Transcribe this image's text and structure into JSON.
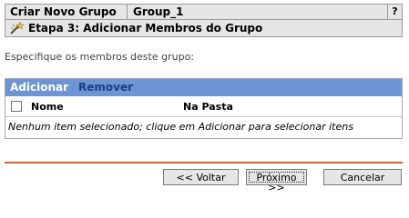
{
  "header": {
    "title": "Criar Novo Grupo",
    "object_name": "Group_1",
    "help_label": "?"
  },
  "step": {
    "icon": "wizard-wand-icon",
    "label": "Etapa 3: Adicionar Membros do Grupo"
  },
  "instruction": "Especifique os membros deste grupo:",
  "table": {
    "actions": {
      "add_label": "Adicionar",
      "remove_label": "Remover"
    },
    "columns": [
      "Nome",
      "Na Pasta"
    ],
    "empty_message": "Nenhum item selecionado; clique em Adicionar para selecionar itens"
  },
  "footer": {
    "back_label": "<< Voltar",
    "next_label": "Próximo >>",
    "cancel_label": "Cancelar"
  },
  "colors": {
    "accent_bar": "#6d94d4",
    "divider": "#d9632a",
    "panel": "#e6e6e6"
  }
}
